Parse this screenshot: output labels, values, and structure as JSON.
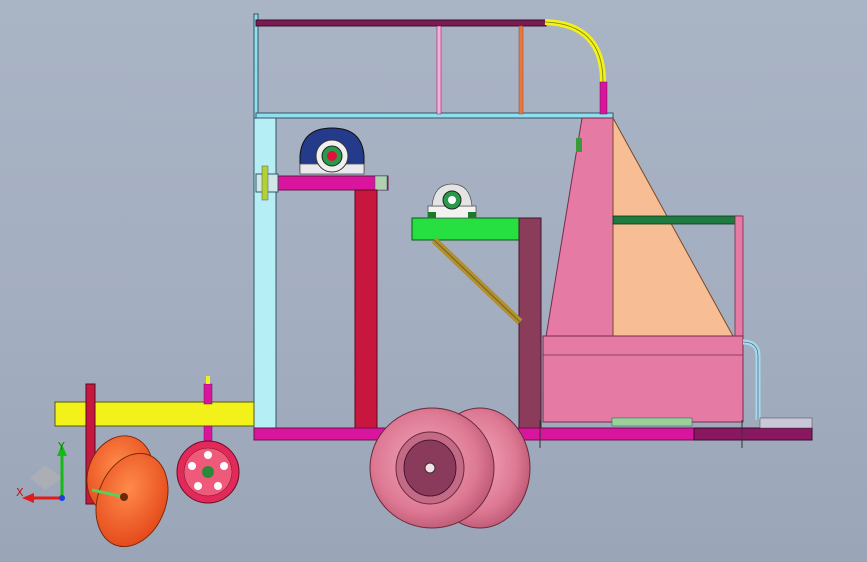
{
  "view": {
    "background_top": "#a9b4c5",
    "background_bottom": "#9aa6b8"
  },
  "triad": {
    "x_label": "X",
    "y_label": "Y",
    "x_color": "#e01b1b",
    "y_color": "#18b818",
    "z_color": "#1b3ee0"
  },
  "model": {
    "colors": {
      "frame_cyan": "#8fe0ee",
      "top_rail": "#7a1a52",
      "chassis_magenta": "#d8159c",
      "hitch_yellow": "#f2f21a",
      "hopper_pink": "#e57aa5",
      "hopper_peach": "#f7be95",
      "tire_pink": "#dd7893",
      "disc_orange": "#f05a1e",
      "bracket_green": "#25e040",
      "post_red": "#c8173f",
      "strut_olive": "#b09030",
      "gauge_wheel": "#e22a5a",
      "bearing_navy": "#243a8a"
    }
  }
}
